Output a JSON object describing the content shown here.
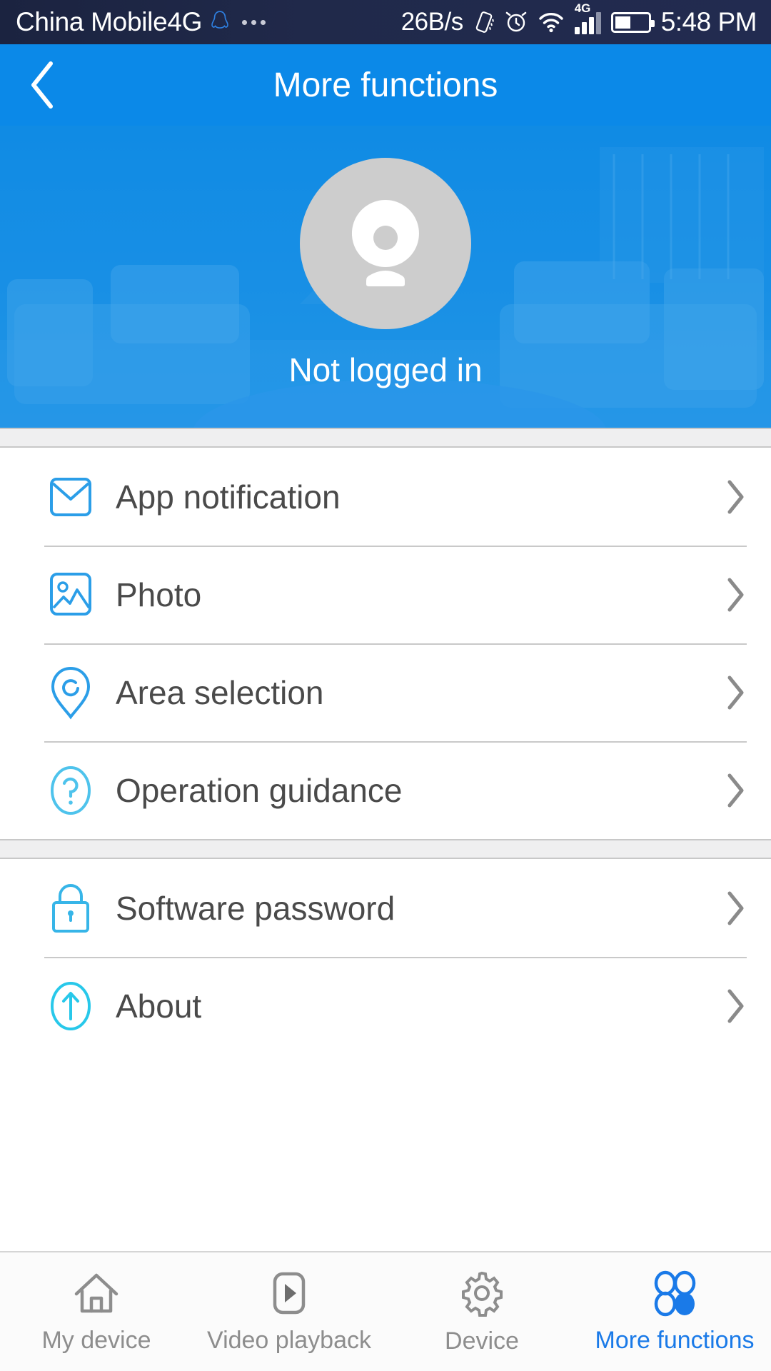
{
  "statusbar": {
    "carrier": "China Mobile4G",
    "qq_icon": "qq-penguin-icon",
    "overflow_icon": "more-dots-icon",
    "network_speed": "26B/s",
    "vibrate_icon": "vibrate-icon",
    "alarm_icon": "alarm-clock-icon",
    "wifi_icon": "wifi-icon",
    "network_type": "4G",
    "signal_icon": "signal-bars-icon",
    "battery_icon": "battery-icon",
    "battery_level_pct": 42,
    "time": "5:48 PM"
  },
  "header": {
    "back_icon": "back-chevron-icon",
    "title": "More functions",
    "background_color": "#0b89e8"
  },
  "hero": {
    "avatar_icon": "ip-camera-icon",
    "login_status": "Not logged in",
    "background_description": "living-room-photo"
  },
  "menu_groups": [
    {
      "items": [
        {
          "label": "App notification",
          "icon": "mail-envelope-icon",
          "chevron": "chevron-right-icon"
        },
        {
          "label": "Photo",
          "icon": "photo-image-icon",
          "chevron": "chevron-right-icon"
        },
        {
          "label": "Area selection",
          "icon": "location-pin-icon",
          "chevron": "chevron-right-icon"
        },
        {
          "label": "Operation guidance",
          "icon": "question-circle-icon",
          "chevron": "chevron-right-icon"
        }
      ]
    },
    {
      "items": [
        {
          "label": "Software password",
          "icon": "padlock-icon",
          "chevron": "chevron-right-icon"
        },
        {
          "label": "About",
          "icon": "arrow-up-circle-icon",
          "chevron": "chevron-right-icon"
        }
      ]
    }
  ],
  "bottom_nav": {
    "items": [
      {
        "label": "My device",
        "icon": "home-icon",
        "active": false
      },
      {
        "label": "Video playback",
        "icon": "play-button-icon",
        "active": false
      },
      {
        "label": "Device",
        "icon": "gear-icon",
        "active": false
      },
      {
        "label": "More functions",
        "icon": "four-circles-icon",
        "active": true
      }
    ],
    "active_color": "#1a7ae8",
    "inactive_color": "#8d8d8d"
  },
  "colors": {
    "accent_blue": "#0b89e8",
    "icon_blue": "#2b9ee8",
    "icon_cyan": "#28c8ea",
    "text_dark": "#4a4a4a"
  }
}
